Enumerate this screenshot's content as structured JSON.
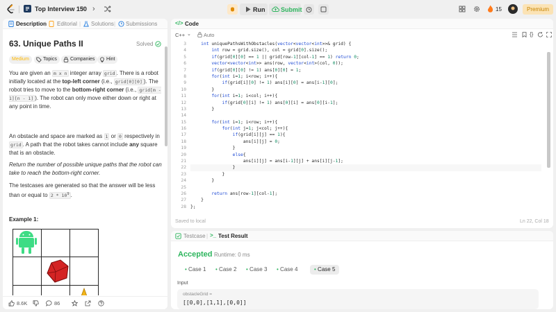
{
  "topbar": {
    "list_title": "Top Interview 150",
    "run_label": "Run",
    "submit_label": "Submit",
    "streak_count": "15",
    "premium_label": "Premium"
  },
  "left_tabs": [
    "Description",
    "Editorial",
    "Solutions",
    "Submissions"
  ],
  "problem": {
    "title": "63. Unique Paths II",
    "status": "Solved",
    "difficulty": "Medium",
    "tags": [
      "Topics",
      "Companies",
      "Hint"
    ],
    "example_title": "Example 1:",
    "likes": "8.6K",
    "comments": "86"
  },
  "code_panel": {
    "title": "Code",
    "language": "C++",
    "auto_label": "Auto",
    "saved_label": "Saved to local",
    "cursor_position": "Ln 22, Col 18",
    "line_numbers": [
      "3",
      "4",
      "5",
      "6",
      "7",
      "8",
      "9",
      "10",
      "11",
      "12",
      "13",
      "14",
      "15",
      "16",
      "17",
      "18",
      "19",
      "20",
      "21",
      "22",
      "23",
      "24",
      "25",
      "26",
      "27",
      "28"
    ],
    "lines": [
      "    int uniquePathsWithObstacles(vector<vector<int>>& grid) {",
      "        int row = grid.size(), col = grid[0].size();",
      "        if(grid[0][0] == 1 || grid[row-1][col-1] == 1) return 0;",
      "        vector<vector<int>> ans(row, vector<int>(col, 0));",
      "        if(grid[0][0] != 1) ans[0][0] = 1;",
      "        for(int i=1; i<row; i++){",
      "            if(grid[i][0] != 1) ans[i][0] = ans[i-1][0];",
      "        }",
      "        for(int i=1; i<col; i++){",
      "            if(grid[0][i] != 1) ans[0][i] = ans[0][i-1];",
      "        }",
      "",
      "        for(int i=1; i<row; i++){",
      "            for(int j=1; j<col; j++){",
      "                if(grid[i][j] == 1){",
      "                    ans[i][j] = 0;",
      "                }",
      "                else{",
      "                    ans[i][j] = ans[i-1][j] + ans[i][j-1];",
      "                }",
      "            }",
      "        }",
      "",
      "        return ans[row-1][col-1];",
      "    }",
      "};"
    ]
  },
  "result_panel": {
    "tab_testcase": "Testcase",
    "tab_result": "Test Result",
    "status": "Accepted",
    "runtime": "Runtime: 0 ms",
    "cases": [
      "Case 1",
      "Case 2",
      "Case 3",
      "Case 4",
      "Case 5"
    ],
    "input_label": "Input",
    "param_name": "obstacleGrid =",
    "param_value": "[[0,0],[1,1],[0,0]]"
  },
  "colors": {
    "accepted": "#2db55d",
    "difficulty": "#ffb800",
    "keyword": "#1f4bd4",
    "premium_text": "#c78400"
  }
}
